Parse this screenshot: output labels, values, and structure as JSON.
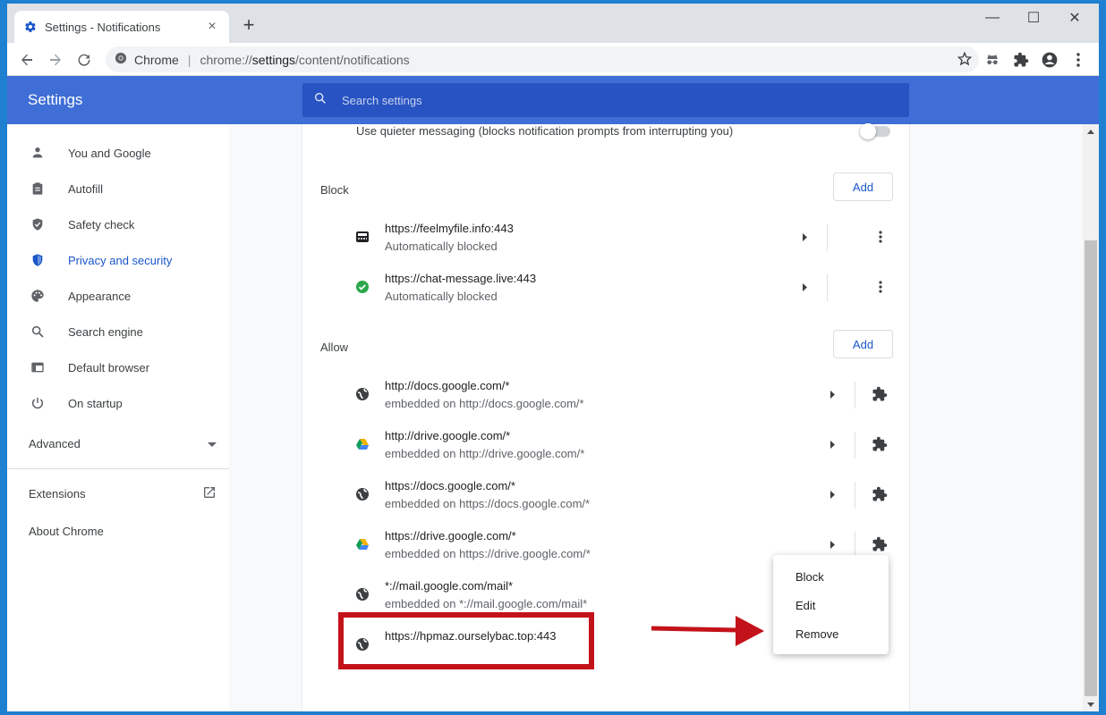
{
  "tab": {
    "title": "Settings - Notifications",
    "favicon": "gear-icon",
    "close": "×"
  },
  "window_controls": {
    "minimize": "—",
    "maximize": "☐",
    "close": "✕"
  },
  "omnibox": {
    "label": "Chrome",
    "separator": "|",
    "url_prefix": "chrome://",
    "url_host": "settings",
    "url_rest": "/content/notifications"
  },
  "header": {
    "brand": "Settings",
    "search_placeholder": "Search settings"
  },
  "nav": {
    "items": [
      {
        "label": "You and Google",
        "icon": "person-icon"
      },
      {
        "label": "Autofill",
        "icon": "clipboard-icon"
      },
      {
        "label": "Safety check",
        "icon": "shield-check-icon"
      },
      {
        "label": "Privacy and security",
        "icon": "shield-icon",
        "active": true
      },
      {
        "label": "Appearance",
        "icon": "palette-icon"
      },
      {
        "label": "Search engine",
        "icon": "search-icon"
      },
      {
        "label": "Default browser",
        "icon": "browser-icon"
      },
      {
        "label": "On startup",
        "icon": "power-icon"
      }
    ],
    "advanced": "Advanced",
    "extensions": "Extensions",
    "about": "About Chrome"
  },
  "content": {
    "quieter_text": "Use quieter messaging (blocks notification prompts from interrupting you)",
    "block": {
      "title": "Block",
      "add_label": "Add",
      "rows": [
        {
          "site": "https://feelmyfile.info:443",
          "sub": "Automatically blocked",
          "icon": "site-favicon-icon"
        },
        {
          "site": "https://chat-message.live:443",
          "sub": "Automatically blocked",
          "icon": "green-check-icon"
        }
      ]
    },
    "allow": {
      "title": "Allow",
      "add_label": "Add",
      "rows": [
        {
          "site": "http://docs.google.com/*",
          "sub": "embedded on http://docs.google.com/*",
          "icon": "globe-icon"
        },
        {
          "site": "http://drive.google.com/*",
          "sub": "embedded on http://drive.google.com/*",
          "icon": "drive-icon"
        },
        {
          "site": "https://docs.google.com/*",
          "sub": "embedded on https://docs.google.com/*",
          "icon": "globe-icon"
        },
        {
          "site": "https://drive.google.com/*",
          "sub": "embedded on https://drive.google.com/*",
          "icon": "drive-icon"
        },
        {
          "site": "*://mail.google.com/mail*",
          "sub": "embedded on *://mail.google.com/mail*",
          "icon": "globe-icon"
        },
        {
          "site": "https://hpmaz.ourselybac.top:443",
          "sub": "",
          "icon": "globe-icon"
        }
      ]
    }
  },
  "context_menu": {
    "items": [
      "Block",
      "Edit",
      "Remove"
    ]
  },
  "colors": {
    "accent": "#1a56c9",
    "header": "#3f6ed6",
    "annotation": "#c4121a"
  }
}
